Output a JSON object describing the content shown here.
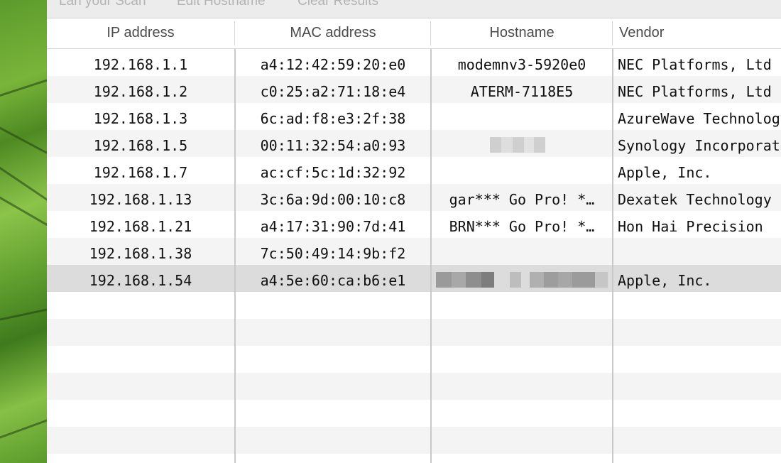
{
  "toolbar": {
    "items": [
      "Lan your Scan",
      "Edit Hostname",
      "Clear Results"
    ]
  },
  "columns": {
    "ip": "IP address",
    "mac": "MAC address",
    "hostname": "Hostname",
    "vendor": "Vendor"
  },
  "rows": [
    {
      "ip": "192.168.1.1",
      "mac": "a4:12:42:59:20:e0",
      "hostname": "modemnv3-5920e0",
      "vendor": "NEC Platforms, Ltd"
    },
    {
      "ip": "192.168.1.2",
      "mac": "c0:25:a2:71:18:e4",
      "hostname": "ATERM-7118E5",
      "vendor": "NEC Platforms, Ltd"
    },
    {
      "ip": "192.168.1.3",
      "mac": "6c:ad:f8:e3:2f:38",
      "hostname": "",
      "vendor": "AzureWave Technology"
    },
    {
      "ip": "192.168.1.5",
      "mac": "00:11:32:54:a0:93",
      "hostname": "",
      "vendor": "Synology Incorporated"
    },
    {
      "ip": "192.168.1.7",
      "mac": "ac:cf:5c:1d:32:92",
      "hostname": "",
      "vendor": "Apple, Inc."
    },
    {
      "ip": "192.168.1.13",
      "mac": "3c:6a:9d:00:10:c8",
      "hostname": "gar*** Go Pro! *…",
      "vendor": "Dexatek Technology"
    },
    {
      "ip": "192.168.1.21",
      "mac": "a4:17:31:90:7d:41",
      "hostname": "BRN*** Go Pro! *…",
      "vendor": "Hon Hai Precision"
    },
    {
      "ip": "192.168.1.38",
      "mac": "7c:50:49:14:9b:f2",
      "hostname": "",
      "vendor": ""
    },
    {
      "ip": "192.168.1.54",
      "mac": "a4:5e:60:ca:b6:e1",
      "hostname": "",
      "vendor": "Apple, Inc."
    }
  ]
}
